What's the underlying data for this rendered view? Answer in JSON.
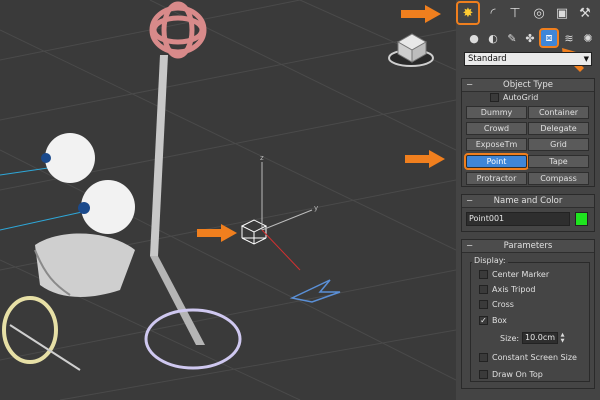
{
  "dropdown": {
    "value": "Standard"
  },
  "object_type": {
    "title": "Object Type",
    "autogrid_label": "AutoGrid",
    "buttons": [
      "Dummy",
      "Container",
      "Crowd",
      "Delegate",
      "ExposeTm",
      "Grid",
      "Point",
      "Tape",
      "Protractor",
      "Compass"
    ],
    "active_button": "Point"
  },
  "name_color": {
    "title": "Name and Color",
    "name_value": "Point001",
    "color": "#1fe51f"
  },
  "parameters": {
    "title": "Parameters",
    "display_label": "Display:",
    "options": [
      {
        "label": "Center Marker",
        "checked": false
      },
      {
        "label": "Axis Tripod",
        "checked": false
      },
      {
        "label": "Cross",
        "checked": false
      },
      {
        "label": "Box",
        "checked": true
      }
    ],
    "size_label": "Size:",
    "size_value": "10.0cm",
    "constant_label": "Constant Screen Size",
    "drawontop_label": "Draw On Top"
  },
  "viewport": {
    "gizmo_z": "z",
    "gizmo_y": "y"
  },
  "colors": {
    "accent": "#f07f1e",
    "active": "#3f86d8"
  }
}
